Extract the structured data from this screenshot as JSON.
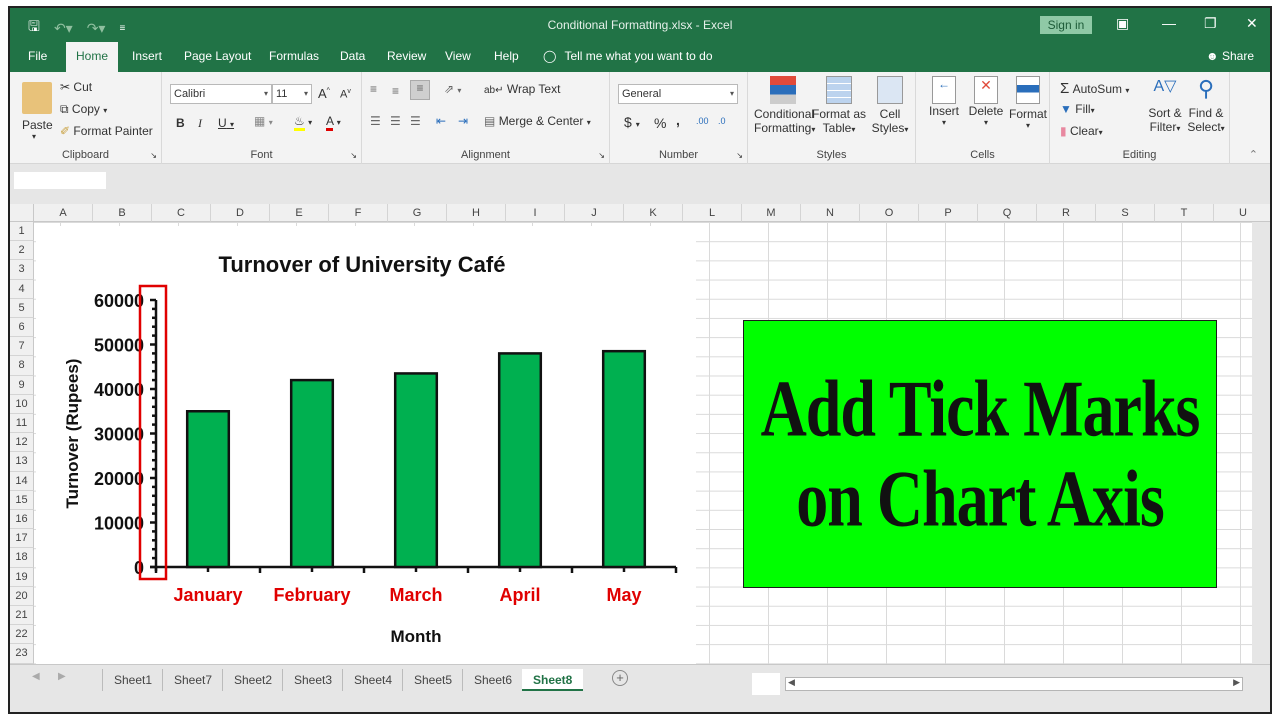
{
  "window": {
    "title": "Conditional Formatting.xlsx  -  Excel",
    "sign_in": "Sign in",
    "share": "Share"
  },
  "qat": {
    "save_icon": "save-icon",
    "undo_icon": "undo-icon",
    "redo_icon": "redo-icon",
    "customize_icon": "customize-qat-icon"
  },
  "tabs": [
    {
      "label": "File"
    },
    {
      "label": "Home",
      "active": true
    },
    {
      "label": "Insert"
    },
    {
      "label": "Page Layout"
    },
    {
      "label": "Formulas"
    },
    {
      "label": "Data"
    },
    {
      "label": "Review"
    },
    {
      "label": "View"
    },
    {
      "label": "Help"
    }
  ],
  "tell_me": "Tell me what you want to do",
  "ribbon": {
    "clipboard": {
      "label": "Clipboard",
      "paste": "Paste",
      "cut": "Cut",
      "copy": "Copy",
      "format_painter": "Format Painter"
    },
    "font": {
      "label": "Font",
      "font_name": "Calibri",
      "font_size": "11",
      "bold": "B",
      "italic": "I",
      "underline": "U",
      "increase": "A",
      "decrease": "A"
    },
    "alignment": {
      "label": "Alignment",
      "wrap_text": "Wrap Text",
      "merge_center": "Merge & Center"
    },
    "number": {
      "label": "Number",
      "format": "General",
      "currency": "$",
      "percent": "%",
      "comma": ",",
      "inc_decimal": ".00",
      "dec_decimal": ".0"
    },
    "styles": {
      "label": "Styles",
      "conditional_1": "Conditional",
      "conditional_2": "Formatting",
      "format_table_1": "Format as",
      "format_table_2": "Table",
      "cell_styles_1": "Cell",
      "cell_styles_2": "Styles"
    },
    "cells": {
      "label": "Cells",
      "insert": "Insert",
      "delete": "Delete",
      "format": "Format"
    },
    "editing": {
      "label": "Editing",
      "autosum": "AutoSum",
      "fill": "Fill",
      "clear": "Clear",
      "sort_1": "Sort &",
      "sort_2": "Filter",
      "find_1": "Find &",
      "find_2": "Select"
    }
  },
  "columns": [
    "A",
    "B",
    "C",
    "D",
    "E",
    "F",
    "G",
    "H",
    "I",
    "J",
    "K",
    "L",
    "M",
    "N",
    "O",
    "P",
    "Q",
    "R",
    "S",
    "T",
    "U"
  ],
  "rows": [
    "1",
    "2",
    "3",
    "4",
    "5",
    "6",
    "7",
    "8",
    "9",
    "10",
    "11",
    "12",
    "13",
    "14",
    "15",
    "16",
    "17",
    "18",
    "19",
    "20",
    "21",
    "22",
    "23"
  ],
  "chart_data": {
    "type": "bar",
    "title": "Turnover of University Café",
    "xlabel": "Month",
    "ylabel": "Turnover (Rupees)",
    "categories": [
      "January",
      "February",
      "March",
      "April",
      "May"
    ],
    "values": [
      35000,
      42000,
      43500,
      48000,
      48500
    ],
    "ylim": [
      0,
      60000
    ],
    "yticks": [
      "0",
      "10000",
      "20000",
      "30000",
      "40000",
      "50000",
      "60000"
    ],
    "minor_ticks_per_major": 5,
    "grid": false,
    "bar_color": "#00b050",
    "category_label_color": "#e00000",
    "highlight_box_color": "#e00000",
    "annotation": "vertical axis tick marks highlighted"
  },
  "callout": {
    "line1": "Add Tick Marks",
    "line2": "on Chart Axis",
    "background": "#00ff00"
  },
  "sheet_tabs": [
    "Sheet1",
    "Sheet7",
    "Sheet2",
    "Sheet3",
    "Sheet4",
    "Sheet5",
    "Sheet6",
    "Sheet8"
  ],
  "active_sheet": "Sheet8"
}
